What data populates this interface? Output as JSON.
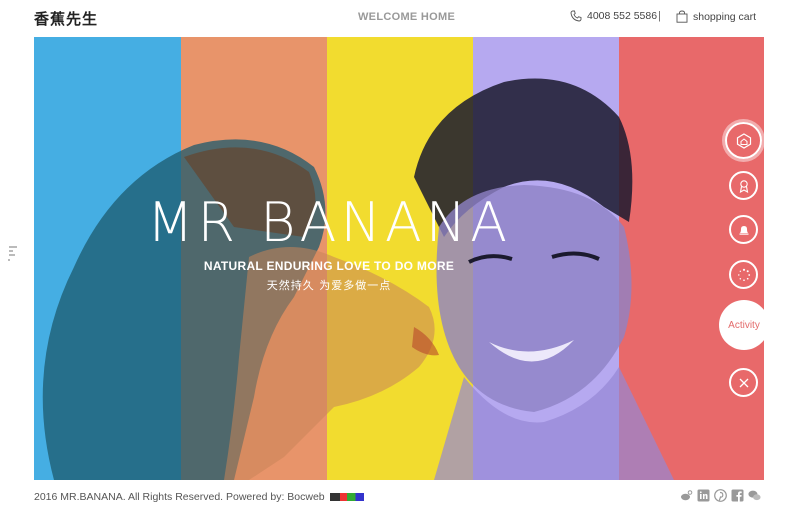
{
  "header": {
    "logo": "香蕉先生",
    "welcome": "WELCOME HOME",
    "phone": "4008 552 5586",
    "separator": "|",
    "cart": "shopping cart"
  },
  "hero": {
    "stripe_colors": [
      "#45aee3",
      "#e8946a",
      "#f2dc2f",
      "#b6a9f0",
      "#e8696a"
    ],
    "title": "MR BANANA",
    "tagline_en": "NATURAL ENDURING  LOVE TO DO MORE",
    "tagline_cn": "天然持久 为爱多做一点",
    "activity_label": "Activity"
  },
  "right_menu": [
    "home-icon",
    "award-icon",
    "bell-icon",
    "loading-icon",
    "activity-button",
    "close-icon"
  ],
  "footer": {
    "copyright": "2016 MR.BANANA. All Rights Reserved. Powered by: Bocweb",
    "social": [
      "weibo-icon",
      "linkedin-icon",
      "pinterest-icon",
      "facebook-icon",
      "wechat-icon"
    ]
  }
}
